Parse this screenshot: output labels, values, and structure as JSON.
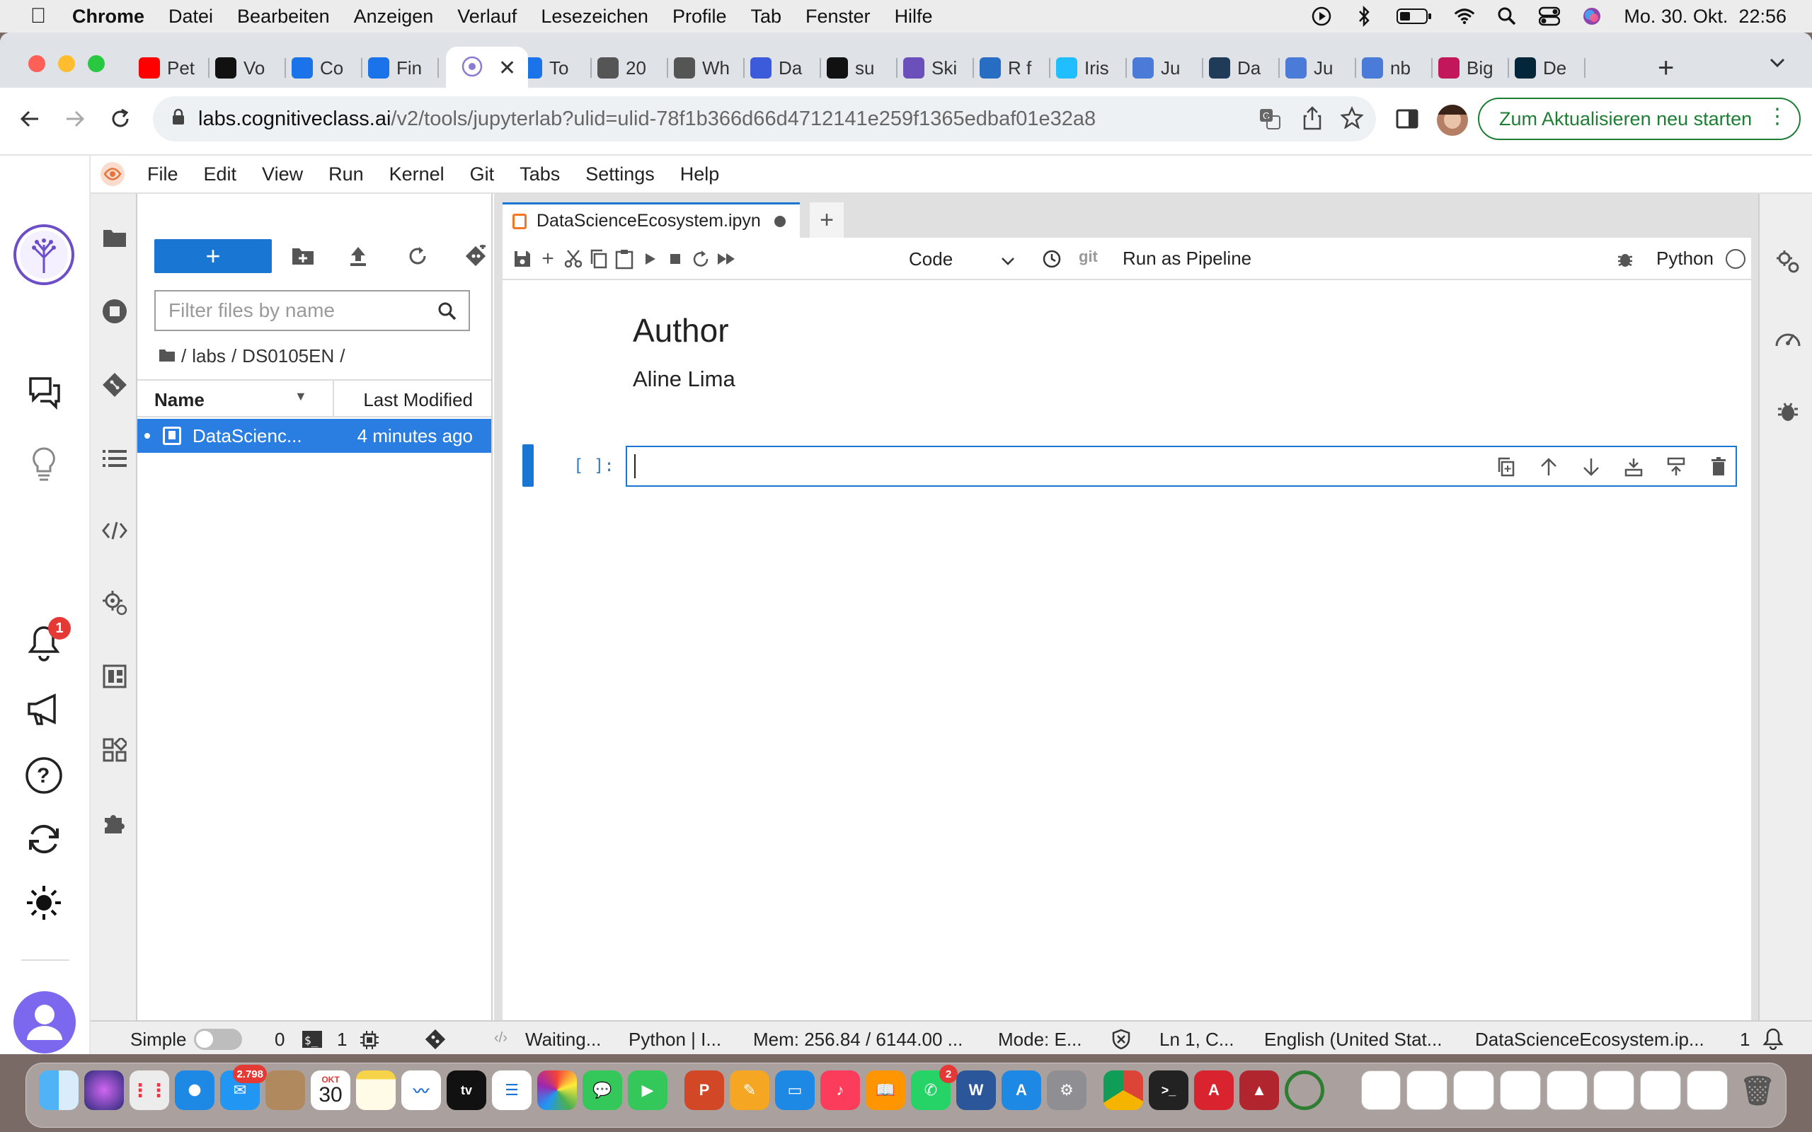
{
  "macos": {
    "app_name": "Chrome",
    "menus": [
      "Datei",
      "Bearbeiten",
      "Anzeigen",
      "Verlauf",
      "Lesezeichen",
      "Profile",
      "Tab",
      "Fenster",
      "Hilfe"
    ],
    "datetime": "Mo. 30. Okt.  22:56"
  },
  "browser": {
    "tabs": [
      {
        "label": "Pet",
        "icon": "youtube-icon",
        "color": "#ff0000"
      },
      {
        "label": "Vo",
        "icon": "kaggle-k-icon",
        "color": "#111111"
      },
      {
        "label": "Co",
        "icon": "coursera-icon",
        "color": "#1a73e8"
      },
      {
        "label": "Fin",
        "icon": "coursera-icon",
        "color": "#1a73e8"
      },
      {
        "label": "To",
        "icon": "coursera-icon",
        "color": "#1a73e8"
      },
      {
        "label": "20",
        "icon": "globe-icon",
        "color": "#555555"
      },
      {
        "label": "Wh",
        "icon": "globe-icon",
        "color": "#555555"
      },
      {
        "label": "Da",
        "icon": "play-triangle-icon",
        "color": "#3b5bdb"
      },
      {
        "label": "su",
        "icon": "github-icon",
        "color": "#111111"
      },
      {
        "label": "Ski",
        "icon": "cognitiveclass-icon",
        "color": "#6b4fbb"
      },
      {
        "label": "R f",
        "icon": "r-icon",
        "color": "#276dc3"
      },
      {
        "label": "Iris",
        "icon": "k-icon",
        "color": "#20beff"
      },
      {
        "label": "Ju",
        "icon": "nb-icon",
        "color": "#4a7bd8"
      },
      {
        "label": "Da",
        "icon": "tds-icon",
        "color": "#1f3b57"
      },
      {
        "label": "Ju",
        "icon": "nb-icon",
        "color": "#4a7bd8"
      },
      {
        "label": "nb",
        "icon": "nb-icon",
        "color": "#4a7bd8"
      },
      {
        "label": "Big",
        "icon": "diamond-icon",
        "color": "#c2185b"
      },
      {
        "label": "De",
        "icon": "datacamp-icon",
        "color": "#03263a"
      }
    ],
    "url_host": "labs.cognitiveclass.ai",
    "url_path": "/v2/tools/jupyterlab?ulid=ulid-78f1b366d66d4712141e259f1365edbaf01e32a8",
    "update_button": "Zum Aktualisieren neu starten"
  },
  "jupyter": {
    "menus": [
      "File",
      "Edit",
      "View",
      "Run",
      "Kernel",
      "Git",
      "Tabs",
      "Settings",
      "Help"
    ],
    "filebrowser": {
      "new_button": "+",
      "filter_placeholder": "Filter files by name",
      "breadcrumb": [
        "labs",
        "DS0105EN"
      ],
      "col_name": "Name",
      "col_modified": "Last Modified",
      "files": [
        {
          "name": "DataScienc...",
          "modified": "4 minutes ago"
        }
      ]
    },
    "notebook": {
      "tab_title": "DataScienceEcosystem.ipyn",
      "cell_type": "Code",
      "git_label": "git",
      "pipeline": "Run as Pipeline",
      "kernel": "Python",
      "md_heading": "Author",
      "md_text": "Aline Lima",
      "prompt": "[ ]:"
    },
    "status": {
      "mode_label": "Simple",
      "zero": "0",
      "one": "1",
      "waiting": "Waiting...",
      "kernel": "Python | I...",
      "mem": "Mem: 256.84 / 6144.00 ...",
      "mode": "Mode: E...",
      "position": "Ln 1, C...",
      "language": "English (United Stat...",
      "filename": "DataScienceEcosystem.ip...",
      "notif_count": "1"
    }
  },
  "rail": {
    "notification_badge": "1"
  },
  "dock": {
    "mail_badge": "2.798",
    "calendar_month": "OKT",
    "calendar_day": "30",
    "whatsapp_badge": "2"
  }
}
